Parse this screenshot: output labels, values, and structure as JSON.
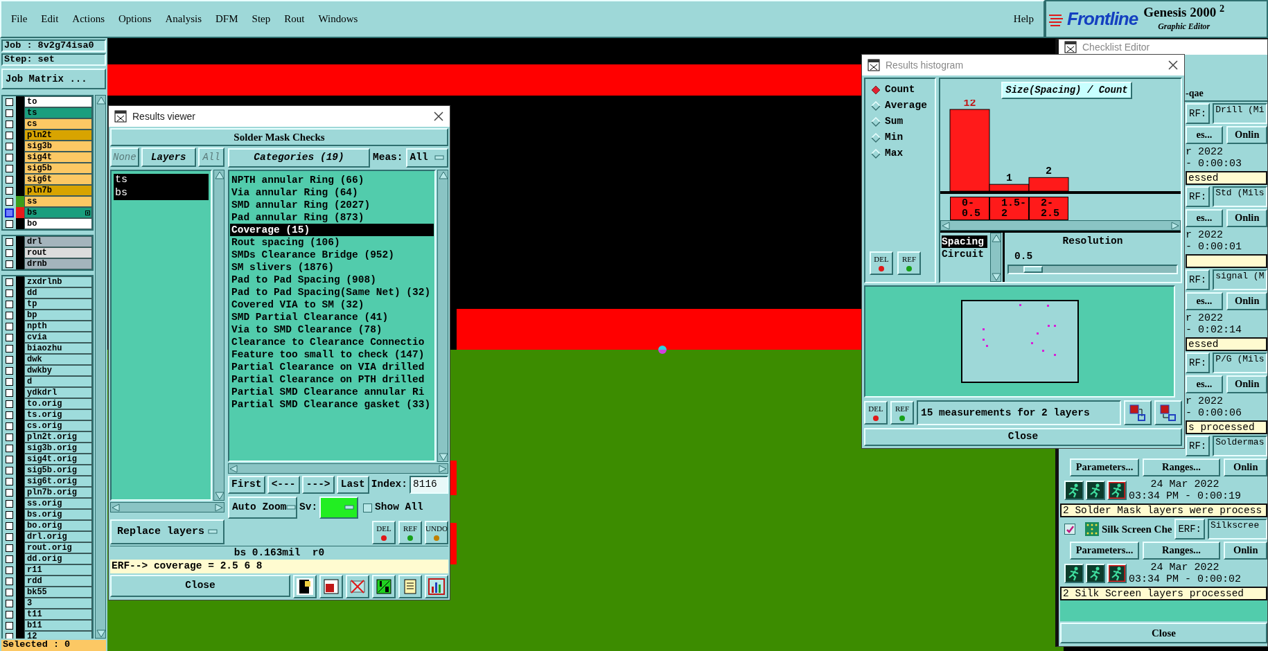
{
  "menu": {
    "items": [
      "File",
      "Edit",
      "Actions",
      "Options",
      "Analysis",
      "DFM",
      "Step",
      "Rout",
      "Windows"
    ],
    "help": "Help"
  },
  "logo": {
    "brand": "Frontline",
    "product": "Genesis 2000 $^{2}$",
    "subtitle": "Graphic Editor"
  },
  "job_panel": {
    "job": "Job : 8v2g74isa0",
    "step": "Step: set",
    "matrix_button": "Job Matrix ...",
    "groups": [
      {
        "layers": [
          {
            "name": "to",
            "color": "#ffffff",
            "work": false
          },
          {
            "name": "ts",
            "color": "#1a9e7e",
            "work": false
          },
          {
            "name": "cs",
            "color": "#fcc864",
            "work": false
          },
          {
            "name": "pln2t",
            "color": "#d8a400",
            "work": false
          },
          {
            "name": "sig3b",
            "color": "#fcc864",
            "work": false
          },
          {
            "name": "sig4t",
            "color": "#fcc864",
            "work": false
          },
          {
            "name": "sig5b",
            "color": "#fcc864",
            "work": false
          },
          {
            "name": "sig6t",
            "color": "#fcc864",
            "work": false
          },
          {
            "name": "pln7b",
            "color": "#d8a400",
            "work": false
          },
          {
            "name": "ss",
            "color": "#fcc864",
            "swatch": {
              "color": "#3c9c1c"
            },
            "work": false
          },
          {
            "name": "bs",
            "color": "#1a9e7e",
            "swatch": {
              "color": "#e81c1c"
            },
            "work": true
          },
          {
            "name": "bo",
            "color": "#ffffff",
            "work": false
          }
        ]
      },
      {
        "layers": [
          {
            "name": "drl",
            "color": "#a4b4bc",
            "work": false
          },
          {
            "name": "rout",
            "color": "#dcdcdc",
            "work": false
          },
          {
            "name": "drnb",
            "color": "#a4b4bc",
            "work": false
          }
        ]
      },
      {
        "layers": [
          {
            "name": "zxdrlnb",
            "color": "#9edcdc",
            "work": false
          },
          {
            "name": "dd",
            "color": "#9edcdc",
            "work": false
          },
          {
            "name": "tp",
            "color": "#9edcdc",
            "work": false
          },
          {
            "name": "bp",
            "color": "#9edcdc",
            "work": false
          },
          {
            "name": "npth",
            "color": "#9edcdc",
            "work": false
          },
          {
            "name": "cvia",
            "color": "#9edcdc",
            "work": false
          },
          {
            "name": "biaozhu",
            "color": "#9edcdc",
            "work": false
          },
          {
            "name": "dwk",
            "color": "#9edcdc",
            "work": false
          },
          {
            "name": "dwkby",
            "color": "#9edcdc",
            "work": false
          },
          {
            "name": "d",
            "color": "#9edcdc",
            "work": false
          },
          {
            "name": "ydkdrl",
            "color": "#9edcdc",
            "work": false
          },
          {
            "name": "to.orig",
            "color": "#9edcdc",
            "work": false
          },
          {
            "name": "ts.orig",
            "color": "#9edcdc",
            "work": false
          },
          {
            "name": "cs.orig",
            "color": "#9edcdc",
            "work": false
          },
          {
            "name": "pln2t.orig",
            "color": "#9edcdc",
            "work": false
          },
          {
            "name": "sig3b.orig",
            "color": "#9edcdc",
            "work": false
          },
          {
            "name": "sig4t.orig",
            "color": "#9edcdc",
            "work": false
          },
          {
            "name": "sig5b.orig",
            "color": "#9edcdc",
            "work": false
          },
          {
            "name": "sig6t.orig",
            "color": "#9edcdc",
            "work": false
          },
          {
            "name": "pln7b.orig",
            "color": "#9edcdc",
            "work": false
          },
          {
            "name": "ss.orig",
            "color": "#9edcdc",
            "work": false
          },
          {
            "name": "bs.orig",
            "color": "#9edcdc",
            "work": false
          },
          {
            "name": "bo.orig",
            "color": "#9edcdc",
            "work": false
          },
          {
            "name": "drl.orig",
            "color": "#9edcdc",
            "work": false
          },
          {
            "name": "rout.orig",
            "color": "#9edcdc",
            "work": false
          },
          {
            "name": "dd.orig",
            "color": "#9edcdc",
            "work": false
          },
          {
            "name": "r11",
            "color": "#9edcdc",
            "work": false
          },
          {
            "name": "rdd",
            "color": "#9edcdc",
            "work": false
          },
          {
            "name": "bk55",
            "color": "#9edcdc",
            "work": false
          },
          {
            "name": "3",
            "color": "#9edcdc",
            "work": false
          },
          {
            "name": "t11",
            "color": "#9edcdc",
            "work": false
          },
          {
            "name": "b11",
            "color": "#9edcdc",
            "work": false
          },
          {
            "name": "12",
            "color": "#9edcdc",
            "work": false
          }
        ]
      }
    ],
    "selected": "Selected : 0"
  },
  "results_viewer": {
    "title": "Results viewer",
    "header": "Solder Mask Checks",
    "layer_filters": [
      {
        "label": "None",
        "disabled": true
      },
      {
        "label": "Layers",
        "disabled": false
      },
      {
        "label": "All",
        "disabled": true
      }
    ],
    "layers": [
      {
        "name": "ts",
        "selected": true
      },
      {
        "name": "bs",
        "selected": true
      }
    ],
    "replace_menu": "Replace layers",
    "categories_button": "Categories (19)",
    "meas_label": "Meas:",
    "meas_value": "All",
    "categories": [
      {
        "label": "NPTH annular Ring (66)",
        "selected": false
      },
      {
        "label": "Via annular Ring (64)",
        "selected": false
      },
      {
        "label": "SMD annular Ring (2027)",
        "selected": false
      },
      {
        "label": "Pad annular Ring (873)",
        "selected": false
      },
      {
        "label": "Coverage (15)",
        "selected": true
      },
      {
        "label": "Rout spacing (106)",
        "selected": false
      },
      {
        "label": "SMDs Clearance Bridge (952)",
        "selected": false
      },
      {
        "label": "SM slivers (1876)",
        "selected": false
      },
      {
        "label": "Pad to Pad Spacing (908)",
        "selected": false
      },
      {
        "label": "Pad to Pad Spacing(Same Net) (32)",
        "selected": false
      },
      {
        "label": "Covered VIA to SM (32)",
        "selected": false
      },
      {
        "label": "SMD Partial Clearance (41)",
        "selected": false
      },
      {
        "label": "Via to SMD Clearance (78)",
        "selected": false
      },
      {
        "label": "Clearance to Clearance Connectio",
        "selected": false
      },
      {
        "label": "Feature too small to check (147)",
        "selected": false
      },
      {
        "label": "Partial Clearance on VIA drilled",
        "selected": false
      },
      {
        "label": "Partial Clearance on PTH drilled",
        "selected": false
      },
      {
        "label": "Partial SMD Clearance annular Ri",
        "selected": false
      },
      {
        "label": "Partial SMD Clearance gasket (33)",
        "selected": false
      }
    ],
    "nav": [
      "First",
      "<---",
      "--->",
      "Last"
    ],
    "index_label": "Index:",
    "index_value": "8116",
    "zoom_menu": "Auto Zoom",
    "sv_label": "Sv:",
    "show_all": {
      "label": "Show All",
      "checked": false
    },
    "edit_buttons": [
      "DEL",
      "REF",
      "UNDO"
    ],
    "status": "bs 0.163mil  r0",
    "erf_line": "ERF--> coverage = 2.5 6 8",
    "close": "Close"
  },
  "histogram": {
    "title": "Results histogram",
    "modes": [
      {
        "label": "Count",
        "selected": true
      },
      {
        "label": "Average",
        "selected": false
      },
      {
        "label": "Sum",
        "selected": false
      },
      {
        "label": "Min",
        "selected": false
      },
      {
        "label": "Max",
        "selected": false
      }
    ],
    "side_buttons": [
      "DEL",
      "REF"
    ],
    "chart_data": {
      "type": "bar",
      "title": "Size(Spacing) / Count",
      "categories": [
        "0-0.5",
        "1.5-2",
        "2-2.5"
      ],
      "values": [
        12,
        1,
        2
      ],
      "data_labels": true
    },
    "attributes": [
      {
        "label": "Spacing",
        "selected": true
      },
      {
        "label": "Circuit",
        "selected": false
      }
    ],
    "resolution": {
      "label": "Resolution",
      "value": "0.5",
      "level": 0.1
    },
    "bottom_buttons": [
      "DEL",
      "REF"
    ],
    "summary": "15 measurements for 2 layers",
    "close": "Close"
  },
  "checklist": {
    "title": "Checklist Editor",
    "rows": [
      {
        "kind": "title",
        "text": "-qae"
      },
      {
        "kind": "erf",
        "covered": true,
        "erf": "RF:",
        "value": "Drill (Mi"
      },
      {
        "kind": "buttons",
        "covered": true,
        "labels": [
          "es...",
          "Onlin"
        ]
      },
      {
        "kind": "run",
        "covered": true,
        "date": "r 2022",
        "time": "- 0:00:03"
      },
      {
        "kind": "status",
        "covered": true,
        "text": "essed"
      },
      {
        "kind": "erf",
        "covered": true,
        "erf": "RF:",
        "value": "Std (Mils"
      },
      {
        "kind": "buttons",
        "covered": true,
        "labels": [
          "es...",
          "Onlin"
        ]
      },
      {
        "kind": "run",
        "covered": true,
        "date": "r 2022",
        "time": "- 0:00:01"
      },
      {
        "kind": "status",
        "covered": true
      },
      {
        "kind": "erf",
        "covered": true,
        "erf": "RF:",
        "value": "signal (M"
      },
      {
        "kind": "buttons",
        "covered": true,
        "labels": [
          "es...",
          "Onlin"
        ]
      },
      {
        "kind": "run",
        "covered": true,
        "date": "r 2022",
        "time": "- 0:02:14"
      },
      {
        "kind": "status",
        "covered": true,
        "text": "essed"
      },
      {
        "kind": "erf",
        "covered": true,
        "erf": "RF:",
        "value": "P/G (Mils"
      },
      {
        "kind": "buttons",
        "covered": true,
        "labels": [
          "es...",
          "Onlin"
        ]
      },
      {
        "kind": "run",
        "covered": true,
        "date": "r 2022",
        "time": "- 0:00:06"
      },
      {
        "kind": "status",
        "covered": true,
        "text": "s processed"
      },
      {
        "kind": "erf",
        "covered": true,
        "erf": "RF:",
        "value": "Soldermas"
      },
      {
        "kind": "buttons",
        "covered": false,
        "labels": [
          "Parameters...",
          "Ranges...",
          "Onlin"
        ]
      },
      {
        "kind": "run",
        "covered": false,
        "date": "24 Mar 2022",
        "time": "03:34 PM - 0:00:19"
      },
      {
        "kind": "status",
        "covered": false,
        "text": "2 Solder Mask layers were process"
      },
      {
        "kind": "header",
        "checked": true,
        "name": "Silk Screen Che",
        "erf": "ERF:",
        "value": "Silkscree"
      },
      {
        "kind": "buttons",
        "covered": false,
        "labels": [
          "Parameters...",
          "Ranges...",
          "Onlin"
        ]
      },
      {
        "kind": "run",
        "covered": false,
        "date": "24 Mar 2022",
        "time": "03:34 PM - 0:00:02"
      },
      {
        "kind": "status",
        "covered": false,
        "text": "2 Silk Screen layers processed"
      }
    ],
    "close": "Close"
  }
}
